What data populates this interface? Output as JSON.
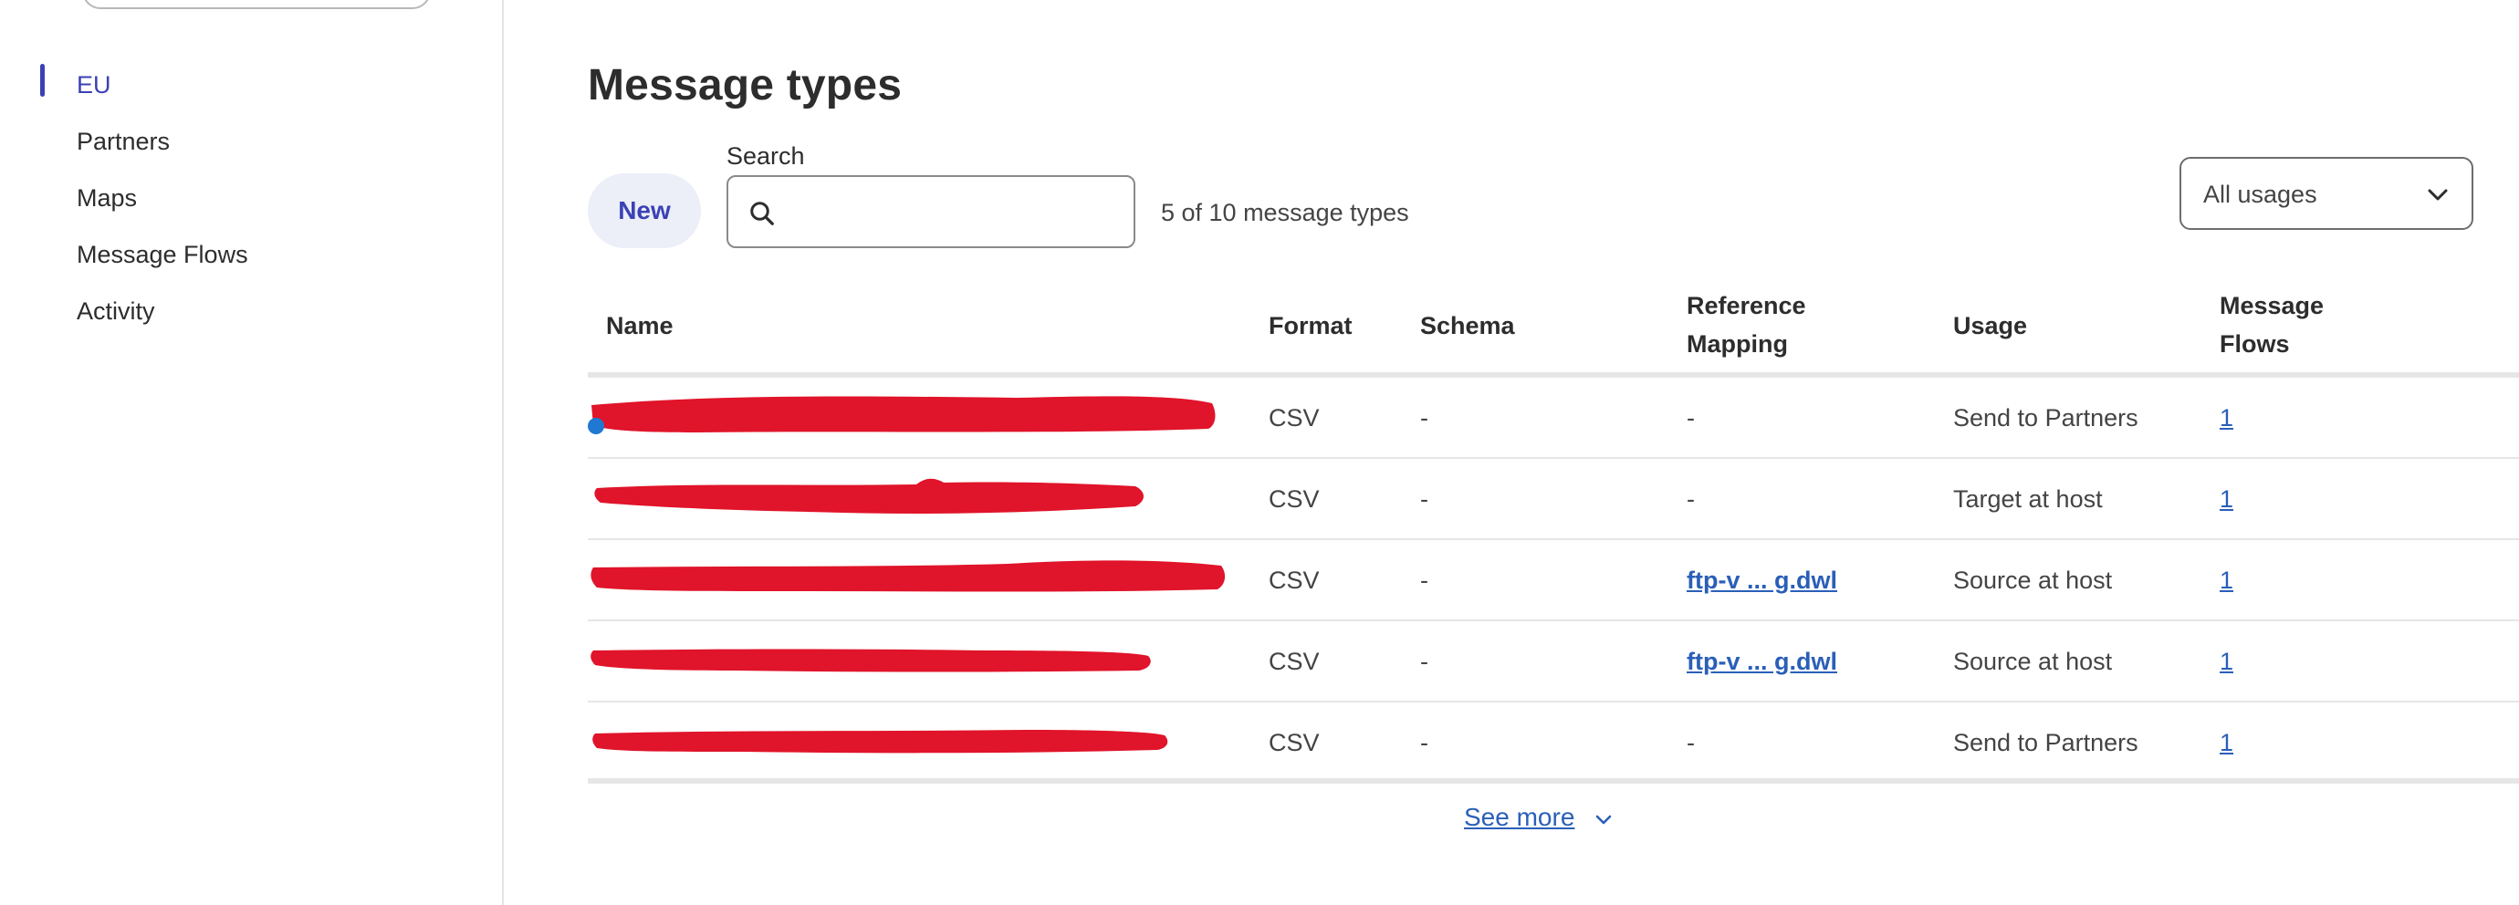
{
  "sidebar": {
    "items": [
      {
        "label": "EU",
        "active": true
      },
      {
        "label": "Partners",
        "active": false
      },
      {
        "label": "Maps",
        "active": false
      },
      {
        "label": "Message Flows",
        "active": false
      },
      {
        "label": "Activity",
        "active": false
      }
    ]
  },
  "main": {
    "title": "Message types",
    "new_label": "New",
    "search": {
      "label": "Search",
      "value": "",
      "placeholder": ""
    },
    "count_text": "5 of 10 message types",
    "usage_filter": {
      "selected": "All usages"
    },
    "columns": {
      "name": "Name",
      "format": "Format",
      "schema": "Schema",
      "reference_mapping_line1": "Reference",
      "reference_mapping_line2": "Mapping",
      "usage": "Usage",
      "message_flows_line1": "Message",
      "message_flows_line2": "Flows"
    },
    "rows": [
      {
        "name": "",
        "format": "CSV",
        "schema": "-",
        "reference_mapping": "-",
        "reference_is_link": false,
        "usage": "Send to Partners",
        "message_flows": "1"
      },
      {
        "name": "",
        "format": "CSV",
        "schema": "-",
        "reference_mapping": "-",
        "reference_is_link": false,
        "usage": "Target at host",
        "message_flows": "1"
      },
      {
        "name": "",
        "format": "CSV",
        "schema": "-",
        "reference_mapping": "ftp-v ... g.dwl",
        "reference_is_link": true,
        "usage": "Source at host",
        "message_flows": "1"
      },
      {
        "name": "",
        "format": "CSV",
        "schema": "-",
        "reference_mapping": "ftp-v ... g.dwl",
        "reference_is_link": true,
        "usage": "Source at host",
        "message_flows": "1"
      },
      {
        "name": "",
        "format": "CSV",
        "schema": "-",
        "reference_mapping": "-",
        "reference_is_link": false,
        "usage": "Send to Partners",
        "message_flows": "1"
      }
    ],
    "see_more_label": "See more"
  },
  "colors": {
    "accent": "#3b41b5",
    "link": "#2a5fb8",
    "redaction": "#e0142a",
    "new_button_bg": "#eceef8"
  }
}
